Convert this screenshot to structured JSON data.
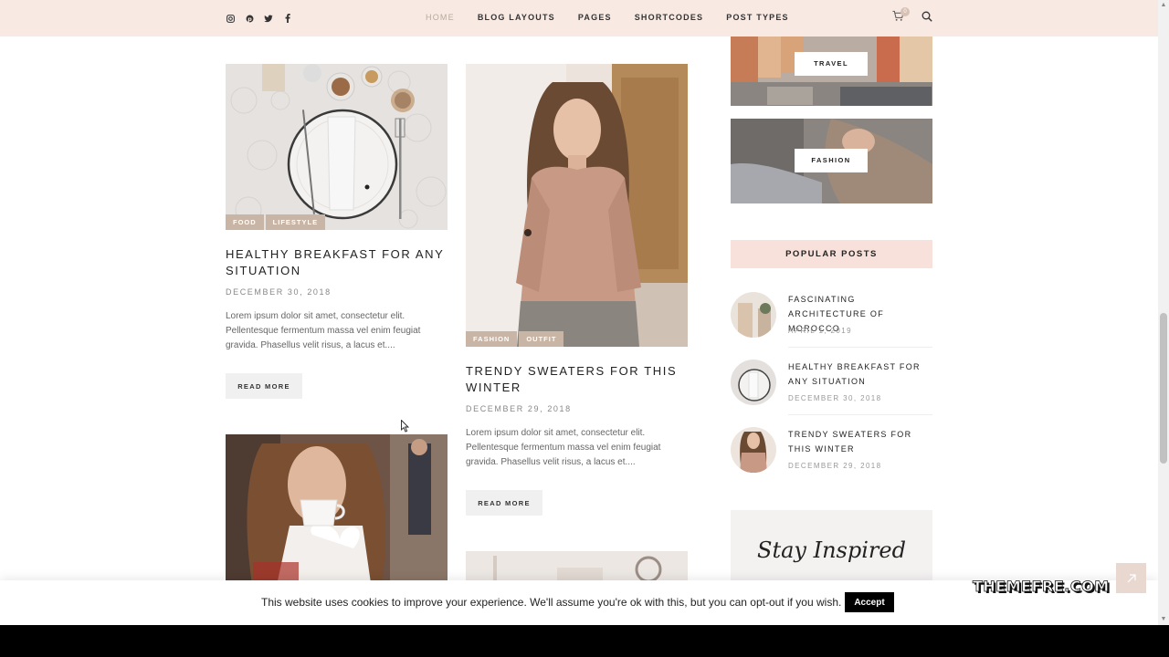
{
  "header": {
    "social": [
      "instagram-icon",
      "pinterest-icon",
      "twitter-icon",
      "facebook-icon"
    ],
    "nav": [
      {
        "label": "HOME",
        "active": true
      },
      {
        "label": "BLOG LAYOUTS"
      },
      {
        "label": "PAGES"
      },
      {
        "label": "SHORTCODES"
      },
      {
        "label": "POST TYPES"
      }
    ],
    "cart_count": "0",
    "bg_color": "#f8e9e3"
  },
  "posts": [
    {
      "categories": [
        "FOOD",
        "LIFESTYLE"
      ],
      "title": "HEALTHY BREAKFAST FOR ANY SITUATION",
      "date": "DECEMBER 30, 2018",
      "excerpt": "Lorem ipsum dolor sit amet, consectetur elit. Pellentesque fermentum massa vel enim feugiat gravida. Phasellus velit risus, a lacus et....",
      "read_more": "READ MORE"
    },
    {
      "categories": [
        "FASHION",
        "OUTFIT"
      ],
      "title": "TRENDY SWEATERS FOR THIS WINTER",
      "date": "DECEMBER 29, 2018",
      "excerpt": "Lorem ipsum dolor sit amet, consectetur elit. Pellentesque fermentum massa vel enim feugiat gravida. Phasellus velit risus, a lacus et....",
      "read_more": "READ MORE"
    }
  ],
  "sidebar": {
    "tiles": [
      {
        "label": "TRAVEL"
      },
      {
        "label": "FASHION"
      }
    ],
    "popular_heading": "POPULAR POSTS",
    "popular": [
      {
        "title": "FASCINATING ARCHITECTURE OF MOROCCO",
        "date": "APRIL 1, 2019"
      },
      {
        "title": "HEALTHY BREAKFAST FOR ANY SITUATION",
        "date": "DECEMBER 30, 2018"
      },
      {
        "title": "TRENDY SWEATERS FOR THIS WINTER",
        "date": "DECEMBER 29, 2018"
      }
    ],
    "inspired_text": "Stay Inspired"
  },
  "cookie": {
    "text": "This website uses cookies to improve your experience. We'll assume you're ok with this, but you can opt-out if you wish.",
    "accept": "Accept"
  },
  "watermark": "THEMEFRE.COM",
  "colors": {
    "accent_pink": "#f8e1da",
    "category_tag": "#c9b5a5"
  }
}
